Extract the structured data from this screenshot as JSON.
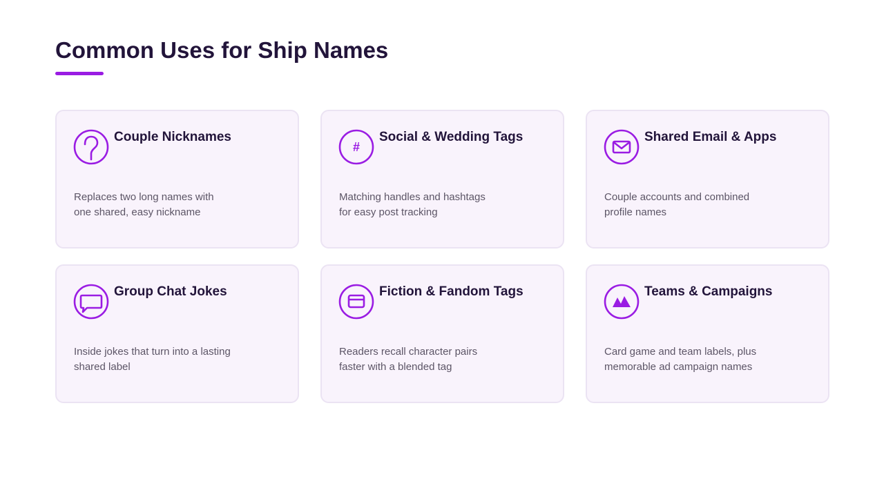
{
  "heading": "Common Uses for Ship Names",
  "accent_color": "#9a1ce3",
  "cards": [
    {
      "title": "Couple Nicknames",
      "description": "Replaces two long names with one shared, easy nickname",
      "icon": "question-icon"
    },
    {
      "title": "Social & Wedding Tags",
      "description": "Matching handles and hashtags for easy post tracking",
      "icon": "hashtag-icon"
    },
    {
      "title": "Shared Email & Apps",
      "description": "Couple accounts and combined profile names",
      "icon": "envelope-icon"
    },
    {
      "title": "Group Chat Jokes",
      "description": "Inside jokes that turn into a lasting shared label",
      "icon": "chat-bubble-icon"
    },
    {
      "title": "Fiction & Fandom Tags",
      "description": "Readers recall character pairs faster with a blended tag",
      "icon": "card-icon"
    },
    {
      "title": "Teams & Campaigns",
      "description": "Card game and team labels, plus memorable ad campaign names",
      "icon": "mountains-icon"
    }
  ]
}
